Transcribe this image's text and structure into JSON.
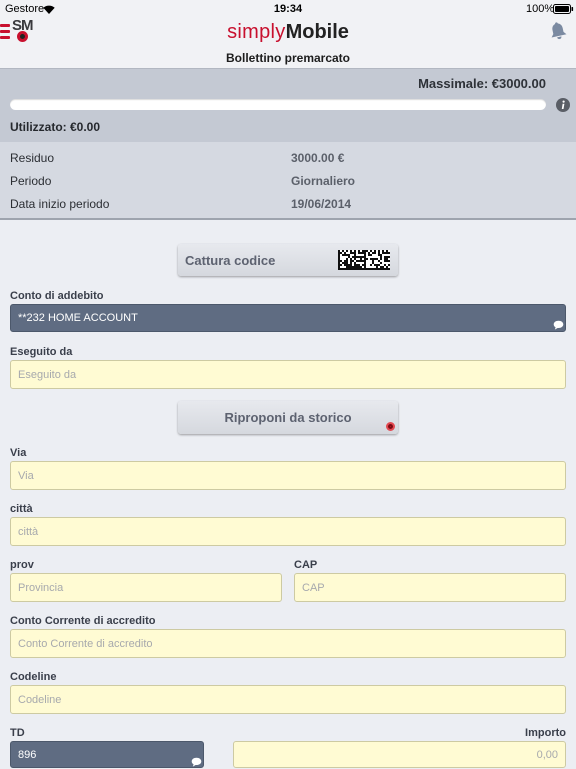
{
  "status_bar": {
    "carrier": "Gestore",
    "time": "19:34",
    "battery_level": "100%"
  },
  "header": {
    "menu_logo": "SM",
    "brand_part1": "simply",
    "brand_part2": "Mobile",
    "title": "Bollettino premarcato"
  },
  "limits": {
    "massimale": "Massimale: €3000.00",
    "utilizzato": "Utilizzato: €0.00",
    "used_percent": 0
  },
  "summary": {
    "rows": [
      {
        "label": "Residuo",
        "value": "3000.00 €"
      },
      {
        "label": "Periodo",
        "value": "Giornaliero"
      },
      {
        "label": "Data inizio periodo",
        "value": "19/06/2014"
      }
    ]
  },
  "actions": {
    "capture_code": "Cattura codice",
    "repeat_history": "Riproponi da storico"
  },
  "form": {
    "conto_addebito": {
      "label": "Conto di addebito",
      "value": "**232 HOME ACCOUNT"
    },
    "eseguito_da": {
      "label": "Eseguito da",
      "placeholder": "Eseguito da"
    },
    "via": {
      "label": "Via",
      "placeholder": "Via"
    },
    "citta": {
      "label": "città",
      "placeholder": "città"
    },
    "prov": {
      "label": "prov",
      "placeholder": "Provincia"
    },
    "cap": {
      "label": "CAP",
      "placeholder": "CAP"
    },
    "conto_accredito": {
      "label": "Conto Corrente di accredito",
      "placeholder": "Conto Corrente di accredito"
    },
    "codeline": {
      "label": "Codeline",
      "placeholder": "Codeline"
    },
    "td": {
      "label": "TD",
      "value": "896"
    },
    "importo": {
      "label": "Importo",
      "placeholder": "0,00"
    }
  },
  "icons": {
    "status_wifi": "wifi-icon",
    "status_battery": "battery-icon",
    "menu": "menu-icon",
    "notifications": "bell-icon",
    "info": "info-icon",
    "capture": "barcode-icon",
    "history": "history-icon",
    "select_indicator": "speech-bubble-icon"
  },
  "colors": {
    "brand_red": "#c8102e",
    "input_fill": "#fffbd3",
    "account_fill": "#5f6c82",
    "limits_panel": "#c4c9d3",
    "summary_panel": "#d5d9e1"
  }
}
